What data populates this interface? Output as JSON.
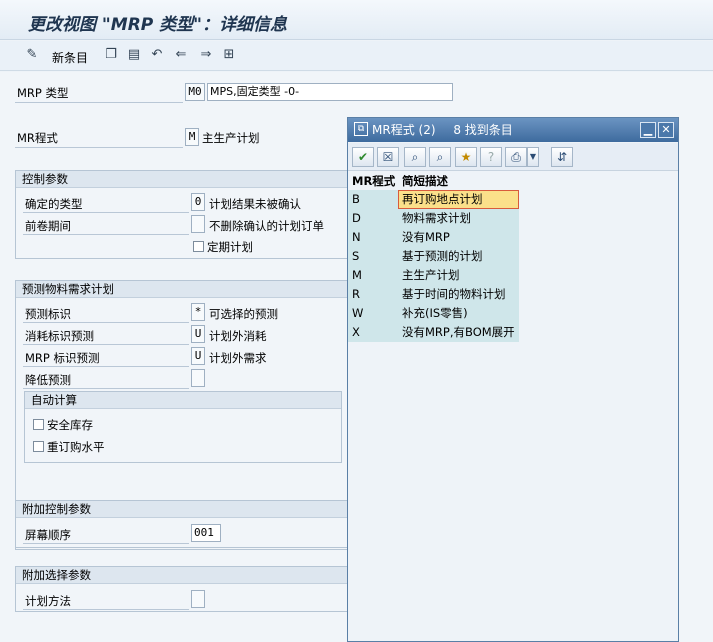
{
  "window": {
    "title": "更改视图 \"MRP 类型\"：详细信息"
  },
  "toolbar": {
    "new_entries": "新条目"
  },
  "fields": {
    "mrp_type_label": "MRP 类型",
    "mrp_type_code": "M0",
    "mrp_type_desc": "MPS,固定类型 -0-",
    "mr_proc_label": "MR程式",
    "mr_proc_code": "M",
    "mr_proc_desc": "主生产计划"
  },
  "control": {
    "header": "控制参数",
    "firm_type_label": "确定的类型",
    "firm_type_value": "0",
    "firm_type_desc": "计划结果未被确认",
    "roll_forward_label": "前卷期间",
    "roll_forward_value": "",
    "roll_forward_desc": "不删除确认的计划订单",
    "periodic_label": "定期计划"
  },
  "forecast": {
    "header": "预测物料需求计划",
    "ind_label": "预测标识",
    "ind_value": "*",
    "ind_desc": "可选择的预测",
    "cons_label": "消耗标识预测",
    "cons_value": "U",
    "cons_desc": "计划外消耗",
    "mrp_label": "MRP 标识预测",
    "mrp_value": "U",
    "mrp_desc": "计划外需求",
    "reduce_label": "降低预测",
    "reduce_value": "",
    "auto_header": "自动计算",
    "safety_stock_label": "安全库存",
    "reorder_label": "重订购水平"
  },
  "additional_control": {
    "header": "附加控制参数",
    "screen_seq_label": "屏幕顺序",
    "screen_seq_value": "001"
  },
  "additional_selection": {
    "header": "附加选择参数",
    "plan_method_label": "计划方法",
    "plan_method_value": ""
  },
  "popup": {
    "title": "MR程式 (2)",
    "found": "8 找到条目",
    "col_key": "MR程式",
    "col_desc": "简短描述",
    "rows": [
      {
        "key": "B",
        "desc": "再订购地点计划"
      },
      {
        "key": "D",
        "desc": "物料需求计划"
      },
      {
        "key": "N",
        "desc": "没有MRP"
      },
      {
        "key": "S",
        "desc": "基于预测的计划"
      },
      {
        "key": "M",
        "desc": "主生产计划"
      },
      {
        "key": "R",
        "desc": "基于时间的物料计划"
      },
      {
        "key": "W",
        "desc": "补充(IS零售)"
      },
      {
        "key": "X",
        "desc": "没有MRP,有BOM展开"
      }
    ],
    "selected_index": 0
  }
}
